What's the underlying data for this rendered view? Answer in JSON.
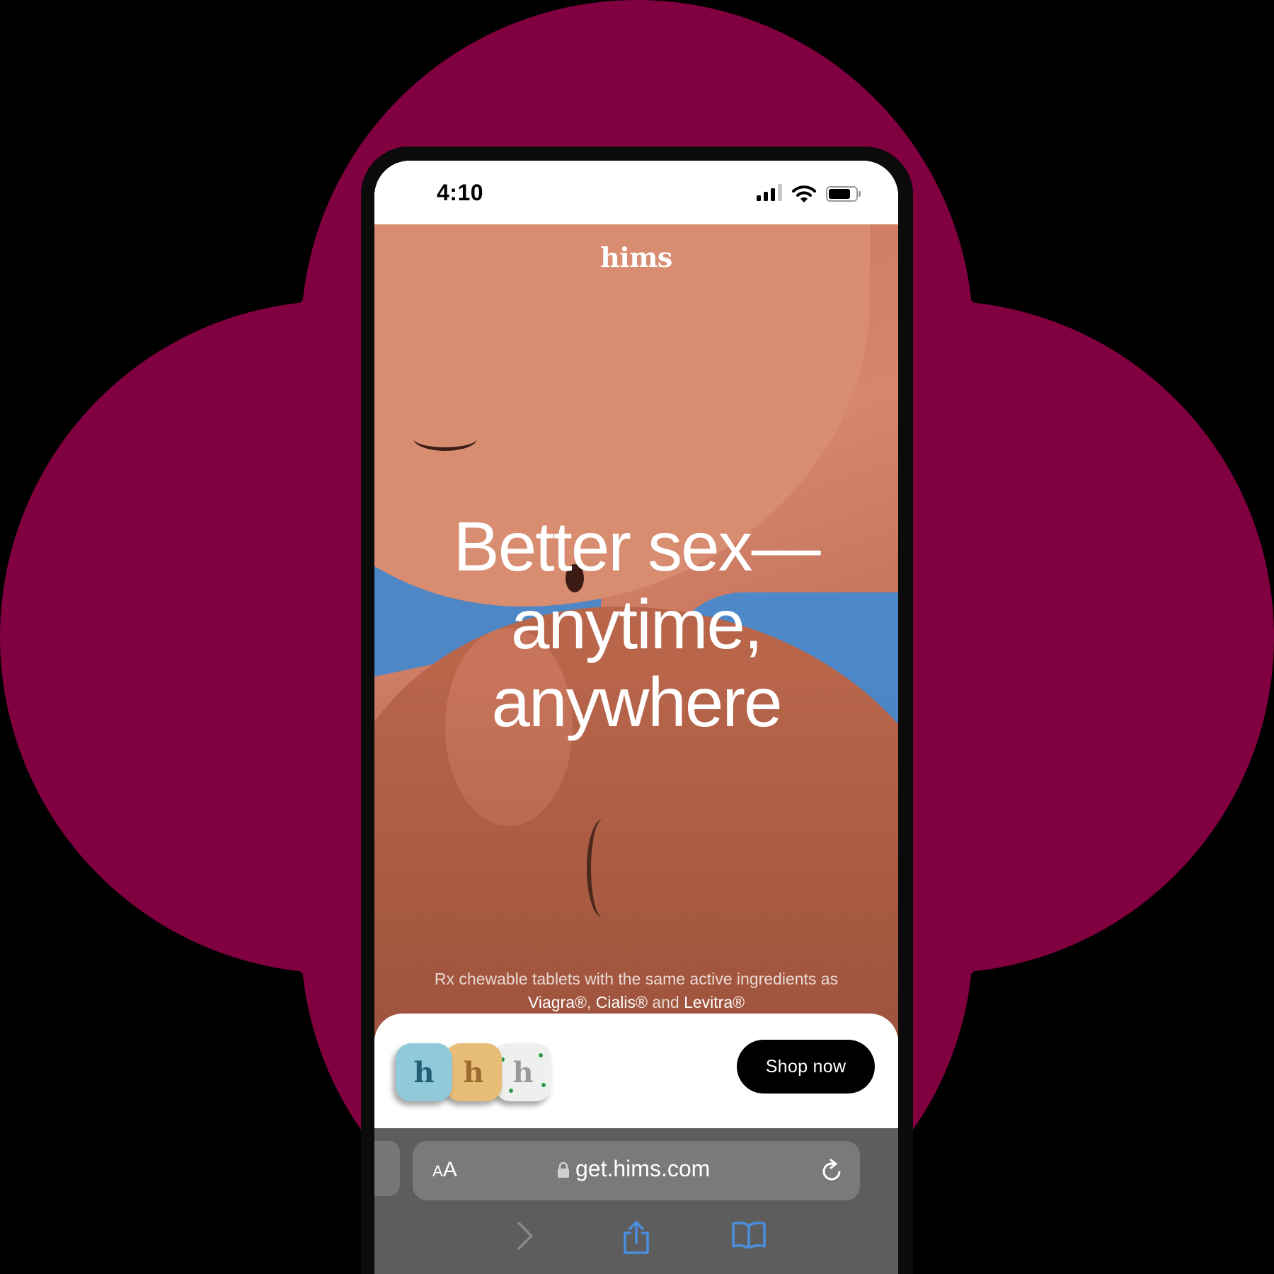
{
  "colors": {
    "bloom_background": "#81003f",
    "button_background": "#000000",
    "browser_chrome": "#5d5d5d",
    "accent_blue": "#4a8fe0"
  },
  "status_bar": {
    "time": "4:10",
    "icons": [
      "cellular-signal-icon",
      "wifi-icon",
      "battery-icon"
    ]
  },
  "hero": {
    "brand": "hims",
    "headline": [
      "Better sex—",
      "anytime,",
      "anywhere"
    ],
    "subcopy": {
      "line1": "Rx chewable tablets with the same active ingredients as",
      "brand1": "Viagra®",
      "sep1": ", ",
      "brand2": "Cialis®",
      "sep2": " and ",
      "brand3": "Levitra®"
    }
  },
  "cta": {
    "pill_letters": [
      "h",
      "h",
      "h"
    ],
    "button_label": "Shop now"
  },
  "browser": {
    "text_size_small": "A",
    "text_size_big": "A",
    "url": "get.hims.com",
    "toolbar_icons": [
      "forward-icon",
      "share-icon",
      "bookmarks-icon"
    ]
  }
}
